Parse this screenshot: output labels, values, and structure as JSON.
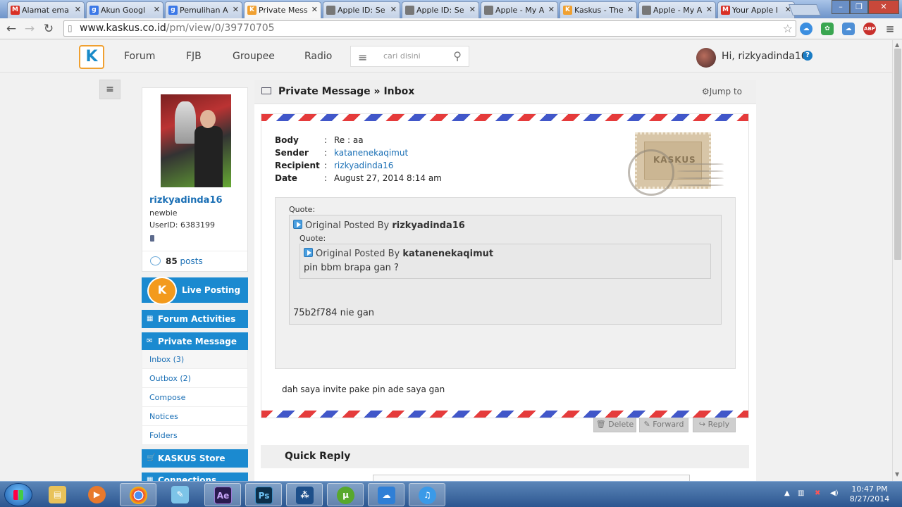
{
  "browser": {
    "tabs": [
      {
        "label": "Alamat ema",
        "icon": "gmail-icon",
        "icon_color": "#d93025",
        "glyph": "M"
      },
      {
        "label": "Akun Googl",
        "icon": "google-icon",
        "icon_color": "#3b78e7",
        "glyph": "g"
      },
      {
        "label": "Pemulihan A",
        "icon": "google-icon",
        "icon_color": "#3b78e7",
        "glyph": "g"
      },
      {
        "label": "Private Mess",
        "icon": "kaskus-icon",
        "icon_color": "#f0a030",
        "glyph": "K",
        "active": true
      },
      {
        "label": "Apple ID: Se",
        "icon": "apple-icon",
        "icon_color": "#777777",
        "glyph": ""
      },
      {
        "label": "Apple ID: Se",
        "icon": "apple-icon",
        "icon_color": "#777777",
        "glyph": ""
      },
      {
        "label": "Apple - My A",
        "icon": "apple-icon",
        "icon_color": "#777777",
        "glyph": ""
      },
      {
        "label": "Kaskus - The",
        "icon": "kaskus-icon",
        "icon_color": "#f0a030",
        "glyph": "K"
      },
      {
        "label": "Apple - My A",
        "icon": "apple-icon",
        "icon_color": "#777777",
        "glyph": ""
      },
      {
        "label": "Your Apple I",
        "icon": "gmail-icon",
        "icon_color": "#d93025",
        "glyph": "M"
      }
    ],
    "url_host": "www.kaskus.co.id",
    "url_path": "/pm/view/0/39770705"
  },
  "site": {
    "nav": [
      "Forum",
      "FJB",
      "Groupee",
      "Radio"
    ],
    "search_placeholder": "cari disini",
    "greeting": "Hi, rizkyadinda16",
    "help": "?"
  },
  "profile": {
    "username": "rizkyadinda16",
    "rank": "newbie",
    "userid": "UserID: 6383199",
    "post_count": "85",
    "posts_label": "posts"
  },
  "sidebar": {
    "live_posting": "Live Posting",
    "forum_activities": "Forum Activities",
    "private_message": "Private Message",
    "pm_items": [
      "Inbox (3)",
      "Outbox (2)",
      "Compose",
      "Notices",
      "Folders"
    ],
    "kaskus_store": "KASKUS Store",
    "cut_item": "Connections"
  },
  "message": {
    "header_title": "Private Message » Inbox",
    "jump_to": "Jump to",
    "fields": [
      {
        "key": "Body",
        "value": "Re : aa",
        "link": false
      },
      {
        "key": "Sender",
        "value": "katanenekaqimut",
        "link": true
      },
      {
        "key": "Recipient",
        "value": "rizkyadinda16",
        "link": true
      },
      {
        "key": "Date",
        "value": "August 27, 2014 8:14 am",
        "link": false
      }
    ],
    "stamp_text": "KASKUS",
    "quote_label": "Quote:",
    "outer_quote": {
      "prefix": "Original Posted By",
      "author": "rizkyadinda16",
      "text": "75b2f784 nie gan"
    },
    "inner_quote": {
      "prefix": "Original Posted By",
      "author": "katanenekaqimut",
      "text": "pin bbm brapa gan ?"
    },
    "body": "dah saya invite pake pin ade saya gan",
    "actions": [
      "Delete",
      "Forward",
      "Reply"
    ],
    "quick_reply": "Quick Reply"
  },
  "taskbar": {
    "apps": [
      "explorer",
      "media-player",
      "chrome",
      "notepad",
      "after-effects",
      "photoshop",
      "blackberry",
      "utorrent",
      "icloud",
      "itunes"
    ],
    "ae_label": "Ae",
    "ps_label": "Ps",
    "time": "10:47 PM",
    "date": "8/27/2014"
  }
}
